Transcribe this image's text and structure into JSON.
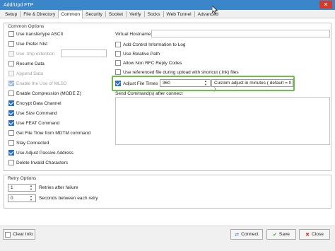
{
  "window": {
    "title": "Add/Upd FTP",
    "close_glyph": "✕"
  },
  "tabs": [
    {
      "label": "Setup"
    },
    {
      "label": "File & Directory"
    },
    {
      "label": "Common"
    },
    {
      "label": "Security"
    },
    {
      "label": "Socket"
    },
    {
      "label": "Verify"
    },
    {
      "label": "Socks"
    },
    {
      "label": "Web Tunnel"
    },
    {
      "label": "Advanced"
    }
  ],
  "common_options": {
    "title": "Common Options",
    "left_checks": [
      {
        "label": "Use transfertype ASCII",
        "checked": false,
        "disabled": false
      },
      {
        "label": "Use Prefer Nlst",
        "checked": false,
        "disabled": false
      },
      {
        "label": "Use .tmp extention",
        "checked": false,
        "disabled": true
      },
      {
        "label": "Resume Data",
        "checked": false,
        "disabled": false
      },
      {
        "label": "Append Data",
        "checked": false,
        "disabled": true
      },
      {
        "label": "Enable the Use of MLSD",
        "checked": true,
        "disabled": true
      },
      {
        "label": "Enable Compression (MODE Z)",
        "checked": false,
        "disabled": false
      },
      {
        "label": "Encrypt Data Channel",
        "checked": true,
        "disabled": false
      },
      {
        "label": "Use Size Command",
        "checked": true,
        "disabled": false
      },
      {
        "label": "Use FEAT Command",
        "checked": true,
        "disabled": false
      },
      {
        "label": "Get File Time from MDTM command",
        "checked": false,
        "disabled": false
      },
      {
        "label": "Stay Connected",
        "checked": false,
        "disabled": false
      },
      {
        "label": "Use Adjust Passive Address",
        "checked": true,
        "disabled": false
      },
      {
        "label": "Delete Invalid Characters",
        "checked": false,
        "disabled": false
      }
    ],
    "tmp_extension_value": "",
    "virtual_hostname_label": "Virtual Hostname",
    "virtual_hostname_value": "",
    "right_checks": [
      {
        "label": "Add Control Information to Log",
        "checked": false
      },
      {
        "label": "Use Relative Path",
        "checked": false
      },
      {
        "label": "Allow Non RFC Reply Codes",
        "checked": false
      },
      {
        "label": "Use referenced file during upload with shortcut (.lnk) files",
        "checked": false
      }
    ],
    "adjust_file_times": {
      "label": "Adjust File Times",
      "checked": true,
      "value": "360",
      "custom_label": "Custom adjust in minutes ( default = 0 )"
    },
    "send_commands_label": "Send Command(s) after connect"
  },
  "retry_options": {
    "title": "Retry Options",
    "retries_value": "1",
    "retries_label": "Retries after failure",
    "seconds_value": "0",
    "seconds_label": "Seconds between each retry"
  },
  "footer": {
    "clear_info_label": "Clear Info",
    "clear_info_checked": false,
    "connect_label": "Connect",
    "save_label": "Save",
    "close_label": "Close"
  }
}
